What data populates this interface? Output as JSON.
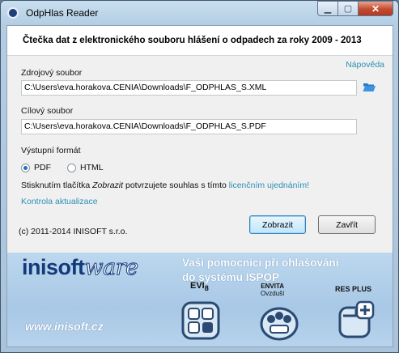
{
  "window": {
    "title": "OdpHlas Reader"
  },
  "header": {
    "title": "Čtečka dat z elektronického souboru hlášení o odpadech za roky 2009 - 2013"
  },
  "help_link": "Nápověda",
  "source": {
    "label": "Zdrojový soubor",
    "value": "C:\\Users\\eva.horakova.CENIA\\Downloads\\F_ODPHLAS_S.XML"
  },
  "target": {
    "label": "Cílový soubor",
    "value": "C:\\Users\\eva.horakova.CENIA\\Downloads\\F_ODPHLAS_S.PDF"
  },
  "format": {
    "label": "Výstupní formát",
    "options": [
      "PDF",
      "HTML"
    ],
    "selected": "PDF"
  },
  "consent": {
    "prefix": "Stisknutím tlačítka ",
    "button_ref": "Zobrazit",
    "middle": " potvrzujete souhlas s tímto ",
    "link": "licenčním ujednáním!"
  },
  "update_link": "Kontrola aktualizace",
  "copyright": "(c) 2011-2014 INISOFT s.r.o.",
  "buttons": {
    "show": "Zobrazit",
    "close": "Zavřít"
  },
  "banner": {
    "logo_a": "inisoft",
    "logo_b": "ware",
    "tagline_line1": "Vaši pomocníci při ohlašování",
    "tagline_line2": "do systému ISPOP",
    "website": "www.inisoft.cz",
    "products": [
      {
        "label": "EVI",
        "sub": "8"
      },
      {
        "label": "ENVITA",
        "sub": "Ovzduší"
      },
      {
        "label": "RES PLUS",
        "sub": ""
      }
    ]
  },
  "colors": {
    "link": "#2d8fb6",
    "accent": "#1f6fc1",
    "brand": "#153a7a"
  }
}
